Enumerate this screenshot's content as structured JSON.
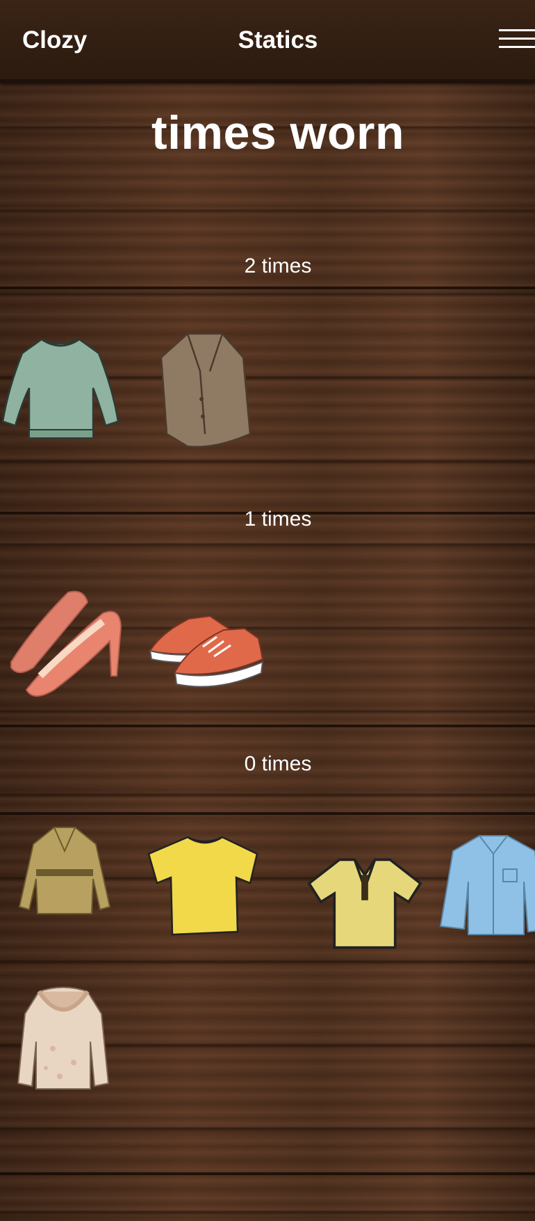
{
  "header": {
    "app_name": "Clozy",
    "title": "Statics"
  },
  "page": {
    "title": "times worn"
  },
  "groups": [
    {
      "label": "2 times",
      "items": [
        {
          "icon": "sweater-icon",
          "color": "#8fb3a0"
        },
        {
          "icon": "coat-icon",
          "color": "#8f7a63"
        }
      ]
    },
    {
      "label": "1 times",
      "items": [
        {
          "icon": "high-heels-icon",
          "color": "#e07e6c"
        },
        {
          "icon": "sneakers-icon",
          "color": "#e0694a"
        }
      ]
    },
    {
      "label": "0 times",
      "items": [
        {
          "icon": "trench-coat-icon",
          "color": "#b8a160"
        },
        {
          "icon": "tshirt-icon",
          "color": "#f1d94a"
        },
        {
          "icon": "polo-shirt-icon",
          "color": "#e6d87a"
        },
        {
          "icon": "denim-shirt-icon",
          "color": "#8fc1e6"
        },
        {
          "icon": "fur-hood-jacket-icon",
          "color": "#e9d6c2"
        }
      ]
    }
  ]
}
